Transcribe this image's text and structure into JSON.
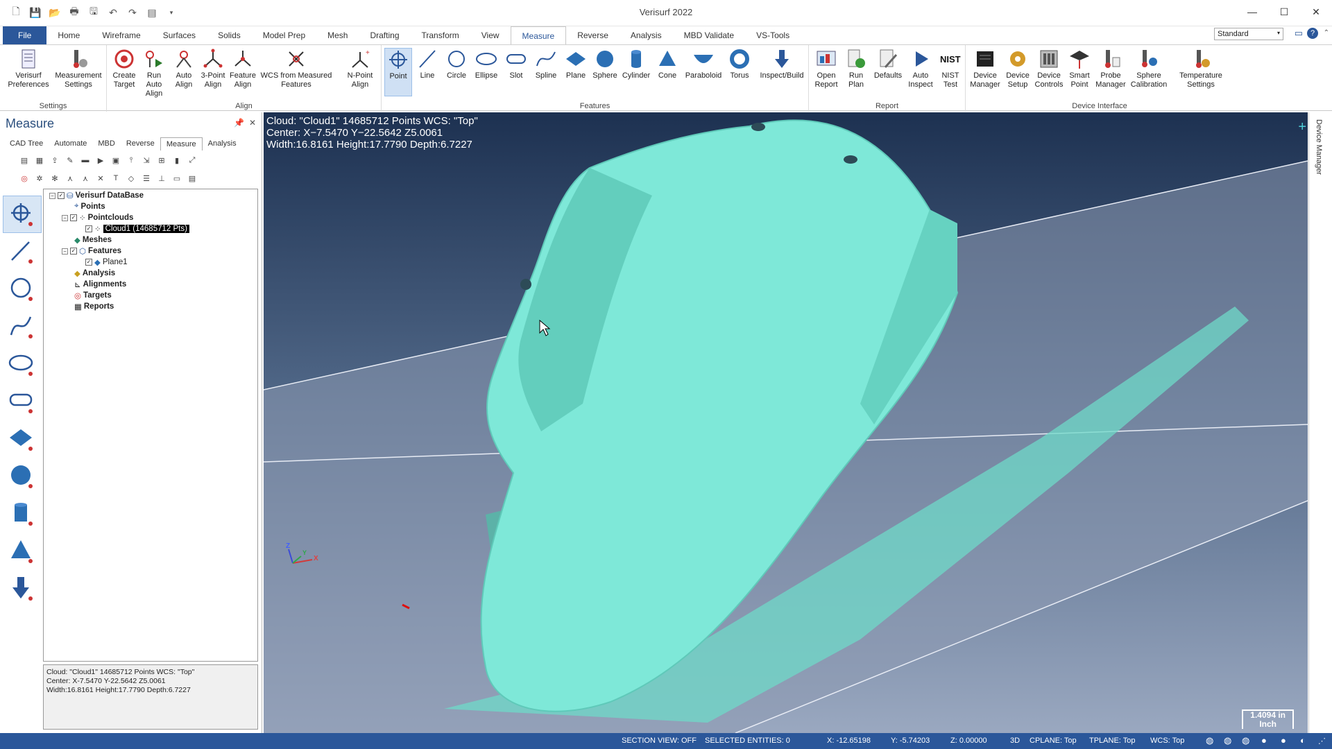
{
  "app": {
    "title": "Verisurf 2022"
  },
  "menu": {
    "tabs": [
      "File",
      "Home",
      "Wireframe",
      "Surfaces",
      "Solids",
      "Model Prep",
      "Mesh",
      "Drafting",
      "Transform",
      "View",
      "Measure",
      "Reverse",
      "Analysis",
      "MBD Validate",
      "VS-Tools"
    ],
    "active": "Measure",
    "style_select": "Standard"
  },
  "ribbon": {
    "settings": {
      "label": "Settings",
      "b1": "Verisurf Preferences",
      "b2": "Measurement Settings"
    },
    "align": {
      "label": "Align",
      "b1": "Create Target",
      "b2": "Run Auto Align",
      "b3": "Auto Align",
      "b4": "3-Point Align",
      "b5": "Feature Align",
      "b6": "WCS from Measured Features",
      "b7": "N-Point Align"
    },
    "features": {
      "label": "Features",
      "b1": "Point",
      "b2": "Line",
      "b3": "Circle",
      "b4": "Ellipse",
      "b5": "Slot",
      "b6": "Spline",
      "b7": "Plane",
      "b8": "Sphere",
      "b9": "Cylinder",
      "b10": "Cone",
      "b11": "Paraboloid",
      "b12": "Torus",
      "b13": "Inspect/Build"
    },
    "report": {
      "label": "Report",
      "b1": "Open Report",
      "b2": "Run Plan",
      "b3": "Defaults",
      "b4": "Auto Inspect",
      "b5": "NIST Test"
    },
    "device": {
      "label": "Device Interface",
      "b1": "Device Manager",
      "b2": "Device Setup",
      "b3": "Device Controls",
      "b4": "Smart Point",
      "b5": "Probe Manager",
      "b6": "Sphere Calibration",
      "b7": "Temperature Settings"
    }
  },
  "panel": {
    "title": "Measure",
    "subtabs": [
      "CAD Tree",
      "Automate",
      "MBD",
      "Reverse",
      "Measure",
      "Analysis"
    ],
    "tree": {
      "root": "Verisurf DataBase",
      "points": "Points",
      "pointclouds": "Pointclouds",
      "cloud1": "Cloud1 (14685712 Pts)",
      "meshes": "Meshes",
      "features": "Features",
      "plane1": "Plane1",
      "analysis": "Analysis",
      "alignments": "Alignments",
      "targets": "Targets",
      "reports": "Reports"
    },
    "info": {
      "line1": "Cloud: \"Cloud1\" 14685712 Points  WCS: \"Top\"",
      "line2": "Center: X-7.5470 Y-22.5642 Z5.0061",
      "line3": "Width:16.8161 Height:17.7790 Depth:6.7227"
    }
  },
  "viewport": {
    "line1": "Cloud: \"Cloud1\" 14685712 Points  WCS: \"Top\"",
    "line2": "Center: X−7.5470 Y−22.5642 Z5.0061",
    "line3": "Width:16.8161 Height:17.7790 Depth:6.7227",
    "scale_value": "1.4094 in",
    "scale_unit": "Inch",
    "axis_z": "Z",
    "axis_x": "X",
    "axis_y": "Y",
    "cloud_color": "#78e5d6"
  },
  "rightrail": {
    "label": "Device Manager"
  },
  "status": {
    "section": "SECTION VIEW: OFF",
    "selected": "SELECTED ENTITIES: 0",
    "x": "X:    -12.65198",
    "y": "Y:    -5.74203",
    "z": "Z:    0.00000",
    "mode": "3D",
    "cplane": "CPLANE: Top",
    "tplane": "TPLANE: Top",
    "wcs": "WCS: Top"
  }
}
